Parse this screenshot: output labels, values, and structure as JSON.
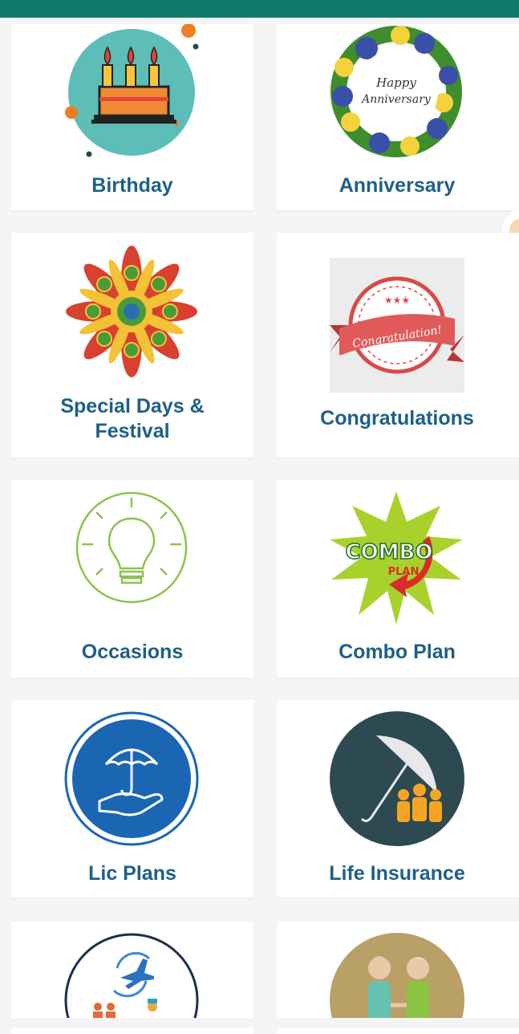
{
  "status_bar": {
    "color": "#0e7a6a"
  },
  "categories": [
    {
      "label": "Birthday",
      "icon": "birthday-cake-icon"
    },
    {
      "label": "Anniversary",
      "icon": "happy-anniversary-wreath-icon",
      "icon_text_1": "Happy",
      "icon_text_2": "Anniversary"
    },
    {
      "label_line1": "Special Days &",
      "label_line2": "Festival",
      "icon": "rangoli-mandala-icon"
    },
    {
      "label": "Congratulations",
      "icon": "congratulation-badge-icon",
      "icon_text": "Congratulation!"
    },
    {
      "label": "Occasions",
      "icon": "light-bulb-icon"
    },
    {
      "label": "Combo Plan",
      "icon": "combo-plan-burst-icon",
      "icon_text_1": "COMBO",
      "icon_text_2": "PLAN"
    },
    {
      "label": "Lic Plans",
      "icon": "umbrella-hand-icon"
    },
    {
      "label": "Life Insurance",
      "icon": "family-umbrella-icon"
    },
    {
      "label": "",
      "icon": "travel-plane-icon"
    },
    {
      "label": "",
      "icon": "elderly-couple-icon"
    }
  ],
  "colors": {
    "label": "#1f5f86",
    "card": "#ffffff",
    "background": "#f5f5f5"
  }
}
